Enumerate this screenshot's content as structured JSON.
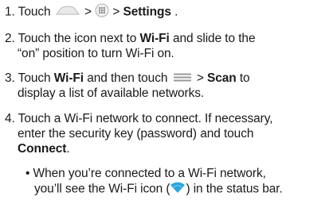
{
  "steps": [
    {
      "number": "1.",
      "prefix": "Touch",
      "gt1": ">",
      "gt2": ">",
      "bold": "Settings",
      "suffix": " ."
    },
    {
      "number": "2.",
      "line1_pre": "Touch the icon next to ",
      "line1_bold": "Wi-Fi",
      "line1_post": " and slide to the",
      "line2": "“on” position to turn Wi-Fi on."
    },
    {
      "number": "3.",
      "line1_pre": "Touch ",
      "line1_bold": "Wi-Fi",
      "line1_mid": " and then touch",
      "gt": ">",
      "line1_bold2": "Scan",
      "line1_post": " to",
      "line2": "display a list of available networks."
    },
    {
      "number": "4.",
      "line1": "Touch a Wi-Fi network to connect. If necessary,",
      "line2": "enter the security key (password) and touch",
      "line3_bold": "Connect",
      "line3_post": "."
    }
  ],
  "bullet": {
    "mark": "•",
    "line1": "When you’re connected to a Wi-Fi network,",
    "line2_pre": "you’ll see the Wi-Fi icon (",
    "line2_post": ") in the status bar."
  },
  "icons": {
    "home": "home-icon",
    "apps": "apps-icon",
    "menu": "menu-icon",
    "wifi": "wifi-icon",
    "wifi_color": "#29a8e0"
  }
}
